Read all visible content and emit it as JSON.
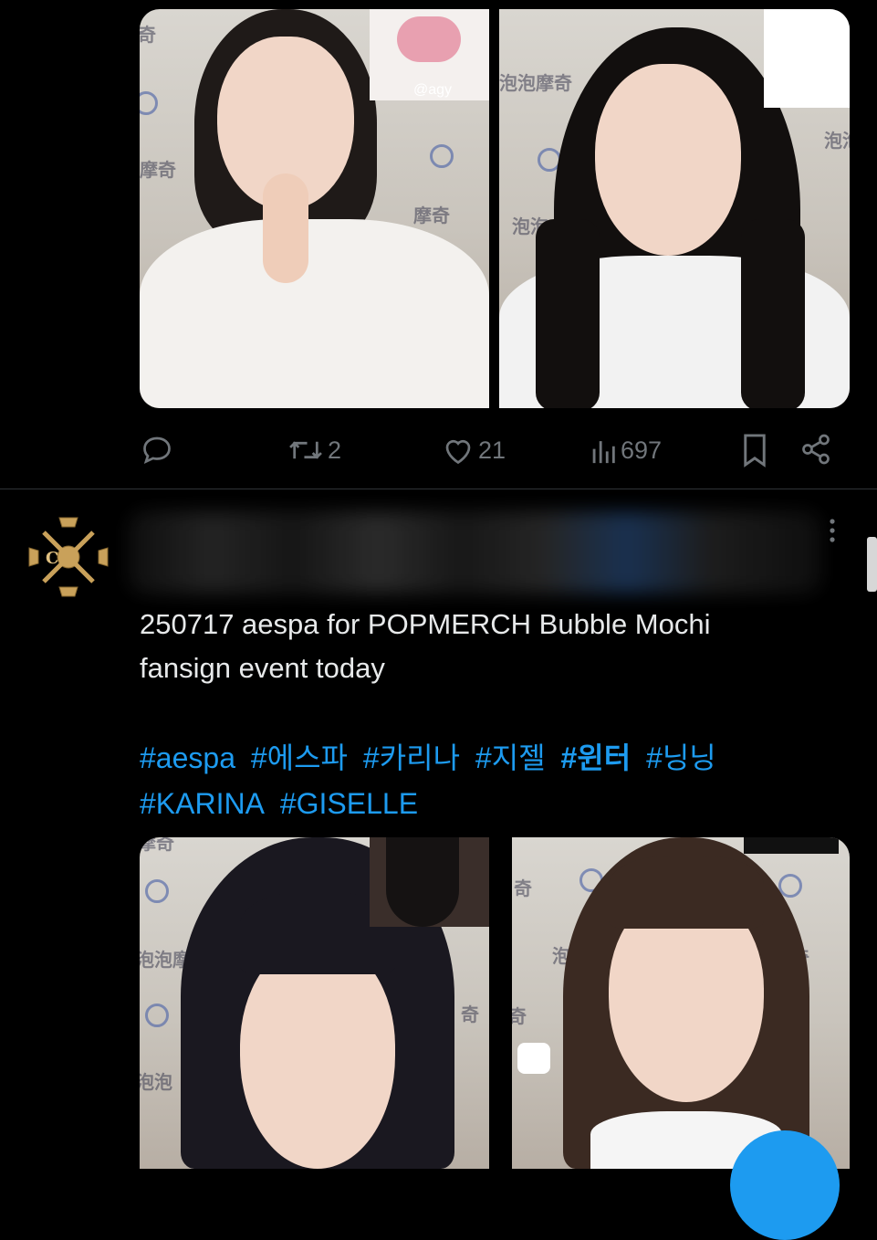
{
  "post1": {
    "image_overlay_tag": "@agy",
    "actions": {
      "reply_count": "",
      "retweet_count": "2",
      "like_count": "21",
      "views_count": "697"
    }
  },
  "post2": {
    "text_line1": "250717 aespa for POPMERCH Bubble Mochi",
    "text_line2": "fansign event today",
    "hashtags": [
      "#aespa",
      "#에스파",
      "#카리나",
      "#지젤",
      "#윈터",
      "#닝닝",
      "#KARINA",
      "#GISELLE"
    ]
  },
  "watermarks": {
    "bubble_mochi": "泡泡摩奇",
    "mochi": "摩奇",
    "bubble": "泡泡",
    "qi": "奇"
  },
  "colors": {
    "background": "#000000",
    "text": "#e7e9ea",
    "muted": "#71767b",
    "accent": "#1d9bf0",
    "divider": "#2f3336",
    "avatar_gold": "#c9a15a"
  },
  "icons": {
    "reply": "reply-icon",
    "retweet": "retweet-icon",
    "like": "heart-icon",
    "views": "views-icon",
    "bookmark": "bookmark-icon",
    "share": "share-icon",
    "more": "more-icon"
  }
}
